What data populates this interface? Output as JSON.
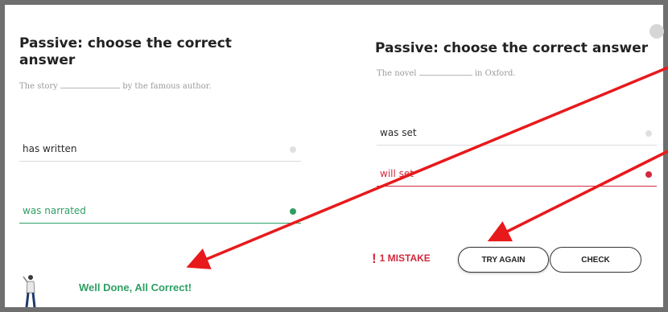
{
  "left": {
    "title_line1": "Passive: choose the correct",
    "title_line2": "answer",
    "sentence_before": "The story",
    "sentence_after": "by the famous author.",
    "options": [
      {
        "label": "has written",
        "state": "neutral"
      },
      {
        "label": "was narrated",
        "state": "correct"
      }
    ],
    "feedback": "Well Done, All Correct!"
  },
  "right": {
    "title": "Passive: choose the correct answer",
    "sentence_before": "The novel",
    "sentence_after": "in Oxford.",
    "options": [
      {
        "label": "was set",
        "state": "neutral"
      },
      {
        "label": "will set",
        "state": "wrong"
      }
    ],
    "mistake_icon": "!",
    "mistake_text": "1 MISTAKE",
    "try_again_label": "TRY AGAIN",
    "check_label": "CHECK"
  },
  "colors": {
    "correct": "#2d9f63",
    "wrong": "#d12a3c",
    "annotation": "#e8191b"
  }
}
